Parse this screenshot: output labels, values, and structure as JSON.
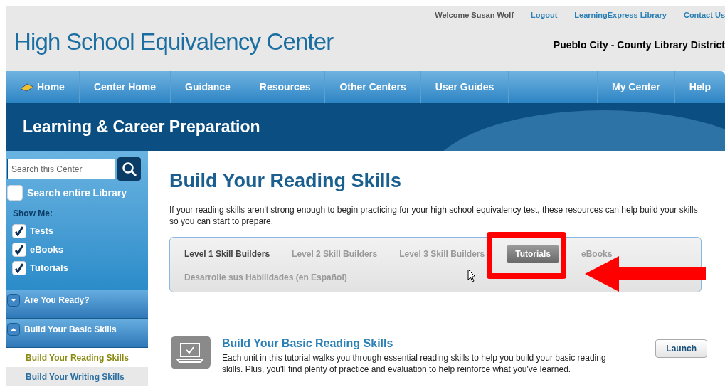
{
  "header": {
    "title": "High School Equivalency Center",
    "welcome": "Welcome Susan Wolf",
    "links": [
      "Logout",
      "LearningExpress Library",
      "Contact Us"
    ],
    "library": "Pueblo City - County Library District"
  },
  "nav": {
    "left": [
      "Home",
      "Center Home",
      "Guidance",
      "Resources",
      "Other Centers",
      "User Guides"
    ],
    "right": [
      "My Center",
      "Help"
    ]
  },
  "banner": {
    "title": "Learning & Career Preparation"
  },
  "sidebar": {
    "search": {
      "placeholder": "Search this Center"
    },
    "search_entire": {
      "label": "Search entire Library",
      "checked": false
    },
    "show_me": "Show Me:",
    "filters": [
      {
        "label": "Tests",
        "checked": true
      },
      {
        "label": "eBooks",
        "checked": true
      },
      {
        "label": "Tutorials",
        "checked": true
      }
    ],
    "sections": [
      {
        "label": "Are You Ready?",
        "expanded": false
      },
      {
        "label": "Build Your Basic Skills",
        "expanded": true,
        "children": [
          {
            "label": "Build Your Reading Skills",
            "selected": true
          },
          {
            "label": "Build Your Writing Skills",
            "selected": false
          }
        ]
      }
    ]
  },
  "main": {
    "title": "Build Your Reading Skills",
    "intro": "If your reading skills aren't strong enough to begin practicing for your high school equivalency test, these resources can help build your skills so you can start to prepare.",
    "tabs": [
      {
        "label": "Level 1 Skill Builders",
        "selected": false,
        "current": true
      },
      {
        "label": "Level 2 Skill Builders",
        "selected": false,
        "current": false
      },
      {
        "label": "Level 3 Skill Builders",
        "selected": false,
        "current": false
      },
      {
        "label": "Tutorials",
        "selected": true,
        "current": false
      },
      {
        "label": "eBooks",
        "selected": false,
        "current": false
      },
      {
        "label": "Desarrolle sus Habilidades (en Español)",
        "selected": false,
        "current": false
      }
    ],
    "items": [
      {
        "title": "Build Your Basic Reading Skills",
        "description": "Each unit in this tutorial walks you through essential reading skills to help you build your basic reading skills. Plus, you'll find plenty of practice and evaluation to help reinforce what you've learned.",
        "button": "Launch"
      }
    ]
  }
}
